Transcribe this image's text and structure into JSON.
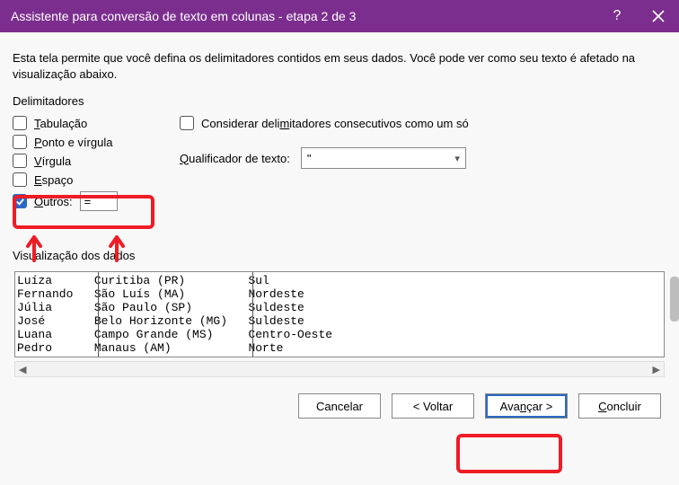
{
  "titlebar": {
    "title": "Assistente para conversão de texto em colunas - etapa 2 de 3"
  },
  "description": "Esta tela permite que você defina os delimitadores contidos em seus dados. Você pode ver como seu texto é afetado na visualização abaixo.",
  "delimiters": {
    "heading": "Delimitadores",
    "tab": "Tabulação",
    "semicolon": "Ponto e vírgula",
    "comma": "Vírgula",
    "space": "Espaço",
    "other_label": "Outros:",
    "other_value": "="
  },
  "options": {
    "consecutive": "Considerar delimitadores consecutivos como um só",
    "qualifier_label": "Qualificador de texto:",
    "qualifier_value": "\""
  },
  "preview": {
    "heading": "Visualização dos dados",
    "rows": [
      {
        "c1": "Luíza",
        "c2": "Curitiba (PR)",
        "c3": "Sul"
      },
      {
        "c1": "Fernando",
        "c2": "São Luís (MA)",
        "c3": "Nordeste"
      },
      {
        "c1": "Júlia",
        "c2": "São Paulo (SP)",
        "c3": "Suldeste"
      },
      {
        "c1": "José",
        "c2": "Belo Horizonte (MG)",
        "c3": "Suldeste"
      },
      {
        "c1": "Luana",
        "c2": "Campo Grande (MS)",
        "c3": "Centro-Oeste"
      },
      {
        "c1": "Pedro",
        "c2": "Manaus (AM)",
        "c3": "Norte"
      }
    ]
  },
  "buttons": {
    "cancel": "Cancelar",
    "back": "< Voltar",
    "next": "Avançar >",
    "finish": "Concluir"
  },
  "annotations": {
    "highlight_color": "#ee1c25"
  }
}
